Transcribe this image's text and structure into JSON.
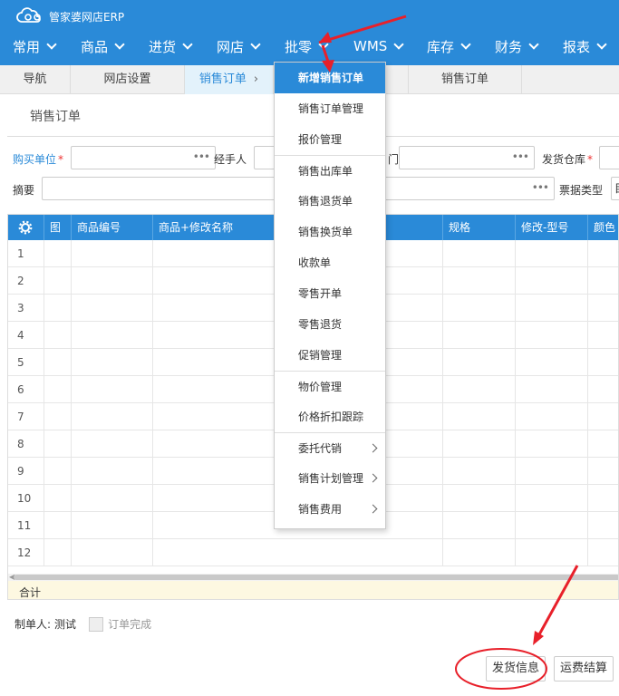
{
  "app": {
    "logo_text": "管家婆网店ERP"
  },
  "menu": [
    {
      "label": "常用"
    },
    {
      "label": "商品"
    },
    {
      "label": "进货"
    },
    {
      "label": "网店"
    },
    {
      "label": "批零"
    },
    {
      "label": "WMS"
    },
    {
      "label": "库存"
    },
    {
      "label": "财务"
    },
    {
      "label": "报表"
    }
  ],
  "tabs": [
    {
      "label": "导航"
    },
    {
      "label": "网店设置"
    },
    {
      "label": "销售订单",
      "active": true
    },
    {
      "label": "销售订单"
    }
  ],
  "page_title": "销售订单",
  "form": {
    "buyer_label": "购买单位",
    "handler_label": "经手人",
    "partial_label": "门",
    "warehouse_label": "发货仓库",
    "summary_label": "摘要",
    "bill_type_label": "票据类型",
    "bill_type_value": "目",
    "dots": "•••",
    "required_mark": "*"
  },
  "grid": {
    "settings_icon": "gear-icon",
    "columns": [
      "图",
      "商品编号",
      "商品+修改名称",
      "规格",
      "修改-型号",
      "颜色"
    ],
    "rows": [
      "1",
      "2",
      "3",
      "4",
      "5",
      "6",
      "7",
      "8",
      "9",
      "10",
      "11",
      "12"
    ],
    "total_label": "合计"
  },
  "footer": {
    "maker_label": "制单人:",
    "maker_value": "测试",
    "complete_label": "订单完成"
  },
  "buttons": {
    "ship_info": "发货信息",
    "freight_settle": "运费结算"
  },
  "dropdown": [
    {
      "label": "新增销售订单",
      "active": true
    },
    {
      "label": "销售订单管理"
    },
    {
      "label": "报价管理"
    },
    {
      "label": "销售出库单",
      "sep": true
    },
    {
      "label": "销售退货单"
    },
    {
      "label": "销售换货单"
    },
    {
      "label": "收款单"
    },
    {
      "label": "零售开单"
    },
    {
      "label": "零售退货"
    },
    {
      "label": "促销管理"
    },
    {
      "label": "物价管理",
      "sep": true
    },
    {
      "label": "价格折扣跟踪"
    },
    {
      "label": "委托代销",
      "sep": true,
      "submenu": true
    },
    {
      "label": "销售计划管理",
      "submenu": true
    },
    {
      "label": "销售费用",
      "submenu": true
    }
  ],
  "colors": {
    "primary": "#2a8ad8",
    "annotation": "#e8202a",
    "total_bg": "#fdf8e1"
  }
}
